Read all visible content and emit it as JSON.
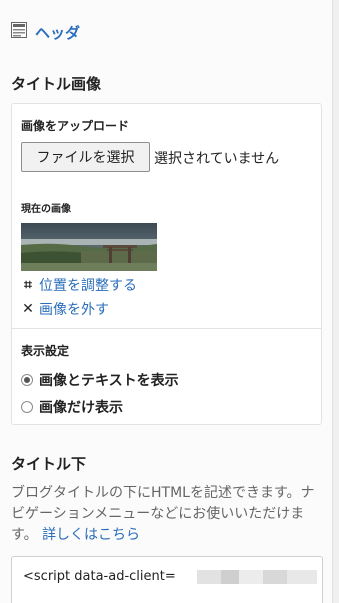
{
  "header": {
    "title": "ヘッダ",
    "icon": "layout-icon"
  },
  "title_image": {
    "section_title": "タイトル画像",
    "upload_label": "画像をアップロード",
    "file_button": "ファイルを選択",
    "file_status": "選択されていません",
    "current_label": "現在の画像",
    "adjust_link": "位置を調整する",
    "remove_link": "画像を外す",
    "display_settings_label": "表示設定",
    "options": [
      {
        "label": "画像とテキストを表示",
        "checked": true
      },
      {
        "label": "画像だけ表示",
        "checked": false
      }
    ]
  },
  "below_title": {
    "section_title": "タイトル下",
    "description": "ブログタイトルの下にHTMLを記述できます。ナビゲーションメニューなどにお使いいただけます。",
    "more_link": "詳しくはこちら",
    "code_value": "<script data-ad-client="
  },
  "colors": {
    "link": "#2a6ebb",
    "text": "#222222",
    "muted": "#666666",
    "card_border": "#e3e3e3"
  }
}
